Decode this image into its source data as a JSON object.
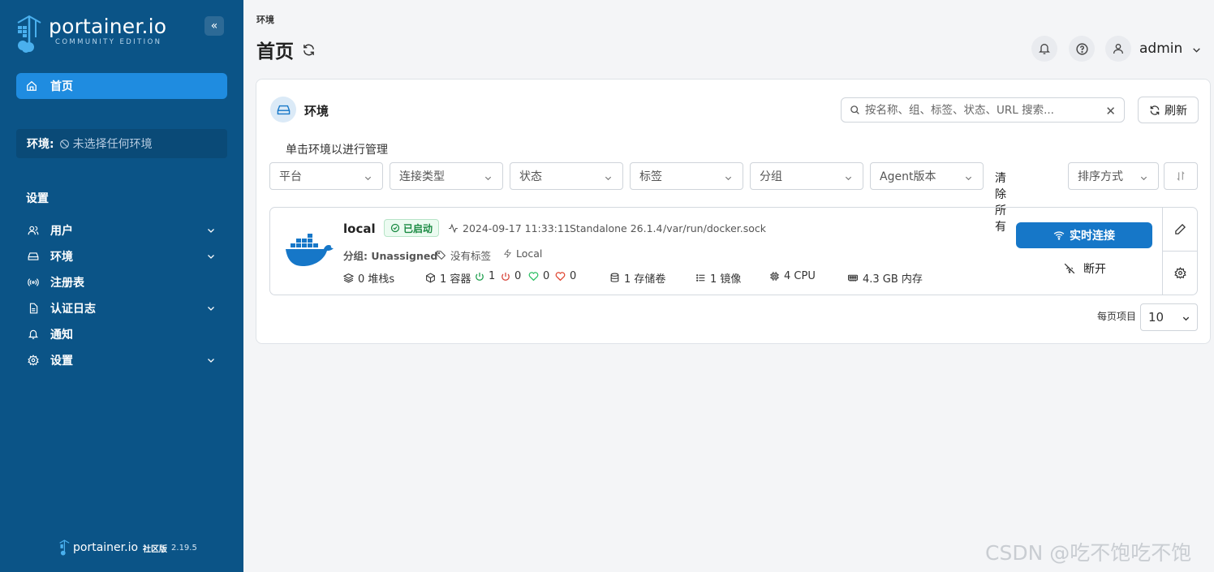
{
  "brand": {
    "name": "portainer.io",
    "edition": "COMMUNITY EDITION"
  },
  "sidebar": {
    "home_label": "首页",
    "env_key": "环境:",
    "env_value": "未选择任何环境",
    "section_label": "设置",
    "items": [
      {
        "label": "用户",
        "icon": "users-icon",
        "has_chevron": true
      },
      {
        "label": "环境",
        "icon": "hdd-icon",
        "has_chevron": true
      },
      {
        "label": "注册表",
        "icon": "radio-icon",
        "has_chevron": false
      },
      {
        "label": "认证日志",
        "icon": "file-icon",
        "has_chevron": true
      },
      {
        "label": "通知",
        "icon": "bell-icon",
        "has_chevron": false
      },
      {
        "label": "设置",
        "icon": "gear-icon",
        "has_chevron": true
      }
    ],
    "footer": {
      "name": "portainer.io",
      "edition": "社区版",
      "version": "2.19.5"
    }
  },
  "header": {
    "breadcrumb": "环境",
    "title": "首页",
    "user": "admin"
  },
  "panel": {
    "title": "环境",
    "search_placeholder": "按名称、组、标签、状态、URL 搜索...",
    "refresh_label": "刷新",
    "hint": "单击环境以进行管理",
    "filters": [
      "平台",
      "连接类型",
      "状态",
      "标签",
      "分组",
      "Agent版本"
    ],
    "clear_all": "清除所有",
    "sort_label": "排序方式",
    "per_page_label": "每页项目",
    "per_page_value": "10"
  },
  "environment": {
    "name": "local",
    "status": "已启动",
    "timestamp": "2024-09-17 11:33:11",
    "type": "Standalone 26.1.4",
    "socket": "/var/run/docker.sock",
    "group": "分组: Unassigned",
    "tags": "没有标签",
    "location": "Local",
    "stacks": "0 堆栈s",
    "containers": "1 容器",
    "running": "1",
    "stopped": "0",
    "healthy": "0",
    "unhealthy": "0",
    "volumes": "1 存储卷",
    "images": "1 镜像",
    "cpu": "4 CPU",
    "memory": "4.3 GB 内存",
    "live_connect": "实时连接",
    "disconnect": "断开"
  },
  "colors": {
    "sidebar_bg": "#0b5487",
    "accent": "#1677c8",
    "running": "#1a9d4a",
    "stopped": "#d64035",
    "healthy": "#2bbf63",
    "unhealthy": "#e0442f"
  },
  "watermark": "CSDN @吃不饱吃不饱"
}
